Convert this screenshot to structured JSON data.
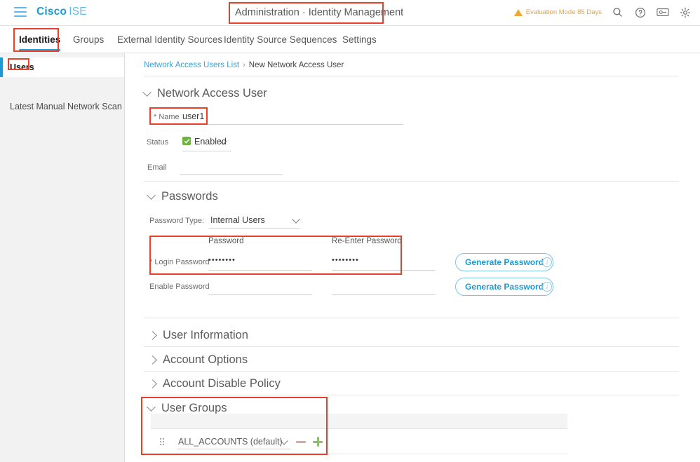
{
  "topbar": {
    "menu_icon": "hamburger-icon",
    "brand_primary": "Cisco",
    "brand_secondary": "ISE",
    "page_title": "Administration · Identity Management",
    "eval_text": "Evaluation Mode 85 Days",
    "warning_icon": "warning-triangle-icon",
    "search_icon": "search-icon",
    "help_icon": "help-circle-icon",
    "feedback_icon": "feedback-monitor-icon",
    "settings_icon": "gear-icon"
  },
  "nav": {
    "tabs": [
      {
        "label": "Identities",
        "active": true
      },
      {
        "label": "Groups",
        "active": false
      },
      {
        "label": "External Identity Sources",
        "active": false
      },
      {
        "label": "Identity Source Sequences",
        "active": false
      },
      {
        "label": "Settings",
        "active": false
      }
    ]
  },
  "sidebar": {
    "items": [
      {
        "label": "Users",
        "active": true
      },
      {
        "label": "Latest Manual Network Scan Res...",
        "active": false
      }
    ]
  },
  "breadcrumb": {
    "link": "Network Access Users List",
    "separator": "›",
    "current": "New Network Access User"
  },
  "sections": {
    "network_access_user": {
      "title": "Network Access User",
      "expanded": true,
      "name_label": "* Name",
      "name_value": "user1",
      "status_label": "Status",
      "status_value": "Enabled",
      "status_checkbox": "checked",
      "email_label": "Email",
      "email_value": ""
    },
    "passwords": {
      "title": "Passwords",
      "expanded": true,
      "password_type_label": "Password Type:",
      "password_type_value": "Internal Users",
      "col_password": "Password",
      "col_reenter": "Re-Enter Password",
      "rows": [
        {
          "label": "* Login Password",
          "password": "••••••••",
          "reenter": "••••••••",
          "button": "Generate Password",
          "info_icon": "info-circle-icon"
        },
        {
          "label": "Enable Password",
          "password": "",
          "reenter": "",
          "button": "Generate Password",
          "info_icon": "info-circle-icon"
        }
      ]
    },
    "user_information": {
      "title": "User Information",
      "expanded": false
    },
    "account_options": {
      "title": "Account Options",
      "expanded": false
    },
    "account_disable_policy": {
      "title": "Account Disable Policy",
      "expanded": false
    },
    "user_groups": {
      "title": "User Groups",
      "expanded": true,
      "rows": [
        {
          "drag_handle": "drag-handle-icon",
          "group": "ALL_ACCOUNTS (default)",
          "remove_icon": "minus-icon",
          "add_icon": "plus-icon"
        }
      ]
    }
  },
  "colors": {
    "brand_blue": "#1b9ad6",
    "accent_blue": "#2aa3d8",
    "status_green": "#6cb33f",
    "warn_orange": "#e8a33d",
    "annotation_red": "#e8412b"
  }
}
